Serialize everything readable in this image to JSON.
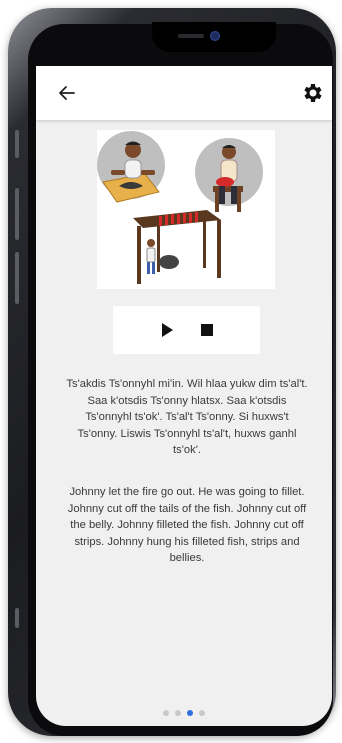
{
  "app_bar": {
    "back_icon": "arrow-left-icon",
    "settings_icon": "gear-icon"
  },
  "illustration": {
    "description_icon": "story-illustration"
  },
  "player": {
    "play_icon": "play-icon",
    "stop_icon": "stop-icon"
  },
  "story": {
    "native_text": "Ts'akdis Ts'onnyhl mi'in. Wil hlaa yukw dim ts'al't. Saa k'otsdis Ts'onny hlatsx. Saa k'otsdis Ts'onnyhl ts'ok'. Ts'al't Ts'onny. Si huxws't Ts'onny. Liswis Ts'onnyhl ts'al't, huxws ganhl ts'ok'.",
    "english_text": "Johnny let the fire go out. He was going to fillet. Johnny cut off the tails of the fish. Johnny cut off the belly. Johnny filleted the fish. Johnny cut off strips. Johnny hung his filleted fish, strips and bellies."
  },
  "pager": {
    "page_count": 4,
    "active_index": 2
  },
  "colors": {
    "screen_bg": "#f0f0f0",
    "accent": "#2f6fe0"
  }
}
